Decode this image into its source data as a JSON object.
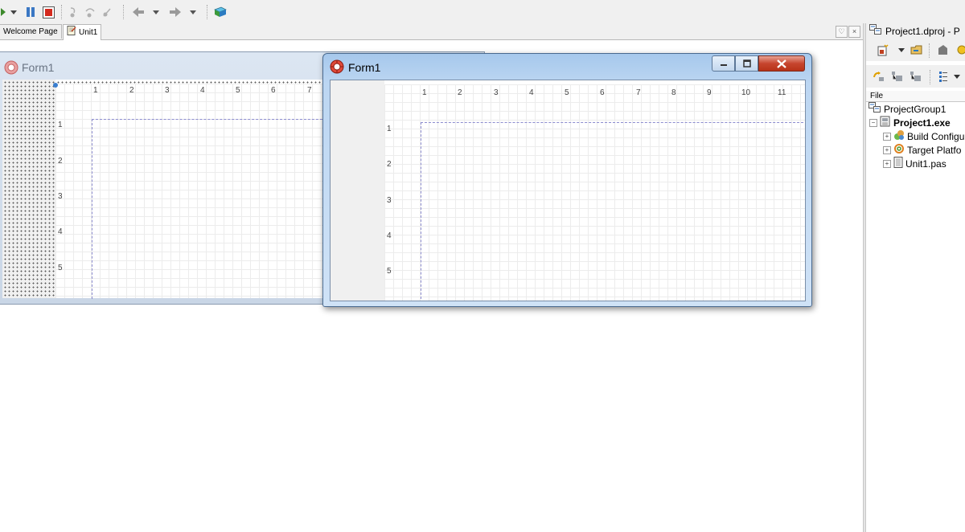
{
  "tabs": [
    "Welcome Page",
    "Unit1"
  ],
  "active_tab": "Unit1",
  "background_form": {
    "title": "Form1",
    "ruler_x": [
      "1",
      "2",
      "3",
      "4",
      "5",
      "6",
      "7"
    ],
    "ruler_y": [
      "1",
      "2",
      "3",
      "4",
      "5"
    ]
  },
  "foreground_form": {
    "title": "Form1",
    "ruler_x": [
      "1",
      "2",
      "3",
      "4",
      "5",
      "6",
      "7",
      "8",
      "9",
      "10",
      "11"
    ],
    "ruler_y": [
      "1",
      "2",
      "3",
      "4",
      "5"
    ]
  },
  "project_manager": {
    "title": "Project1.dproj - P",
    "column_header": "File",
    "tree": [
      {
        "label": "ProjectGroup1",
        "bold": false,
        "icon": "project-group-icon"
      },
      {
        "label": "Project1.exe",
        "bold": true,
        "icon": "project-exe-icon"
      },
      {
        "label": "Build Configu",
        "bold": false,
        "icon": "build-config-icon"
      },
      {
        "label": "Target Platfo",
        "bold": false,
        "icon": "target-platform-icon"
      },
      {
        "label": "Unit1.pas",
        "bold": false,
        "icon": "unit-file-icon"
      }
    ]
  },
  "colors": {
    "accent_blue": "#3a7fd0",
    "close_red": "#c7452e"
  }
}
